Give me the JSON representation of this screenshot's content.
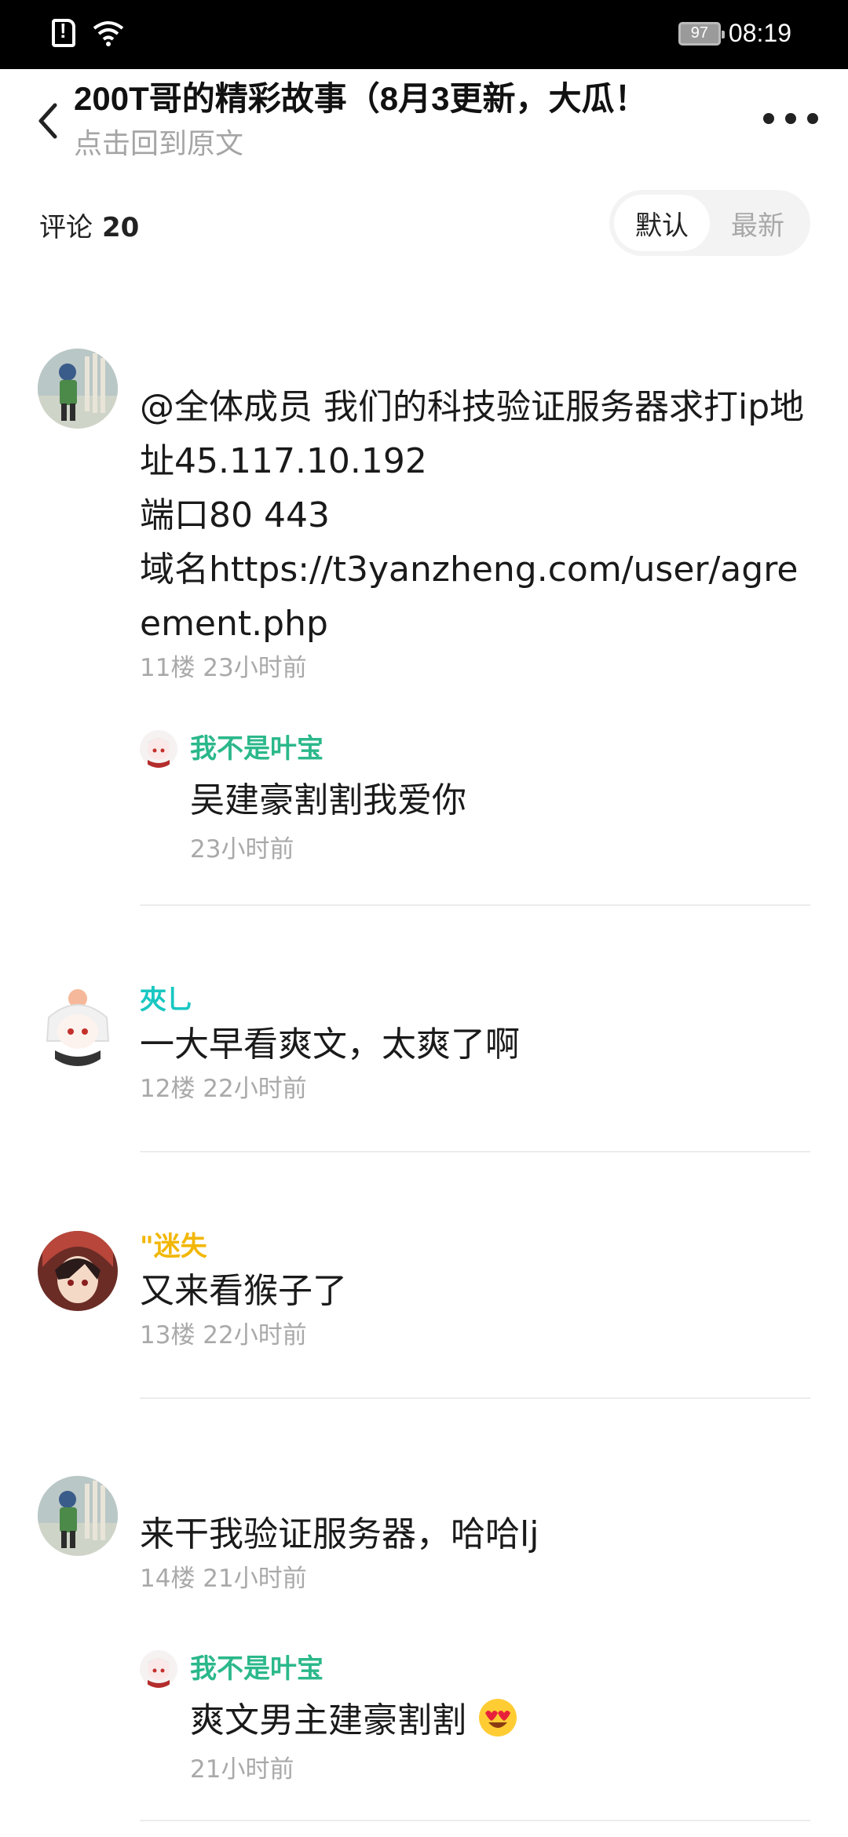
{
  "status_bar": {
    "time": "08:19",
    "battery": "97"
  },
  "header": {
    "title": "200T哥的精彩故事（8月3更新，大瓜！",
    "subtitle": "点击回到原文"
  },
  "comments_bar": {
    "label": "评论",
    "count": "20",
    "sort_default": "默认",
    "sort_latest": "最新"
  },
  "comments": [
    {
      "name": "",
      "text": "@全体成员 我们的科技验证服务器求打ip地址45.117.10.192\n端口80 443\n域名https://t3yanzheng.com/user/agreement.php",
      "meta": "11楼 23小时前",
      "reply": {
        "name": "我不是叶宝",
        "text": "吴建豪割割我爱你",
        "meta": "23小时前"
      }
    },
    {
      "name": "夾乚",
      "name_color": "#19c7c2",
      "text": "一大早看爽文，太爽了啊",
      "meta": "12楼 22小时前"
    },
    {
      "name": "\"迷失",
      "name_color": "#f2b705",
      "text": "又来看猴子了",
      "meta": "13楼 22小时前"
    },
    {
      "name": "",
      "text": "来干我验证服务器，哈哈lj",
      "meta": "14楼 21小时前",
      "reply": {
        "name": "我不是叶宝",
        "text": "爽文男主建豪割割",
        "meta": "21小时前",
        "emoji": "heart-eyes-emoji"
      }
    }
  ],
  "colors": {
    "reply_name": "#2bb88a",
    "meta": "#a9a9a9"
  }
}
